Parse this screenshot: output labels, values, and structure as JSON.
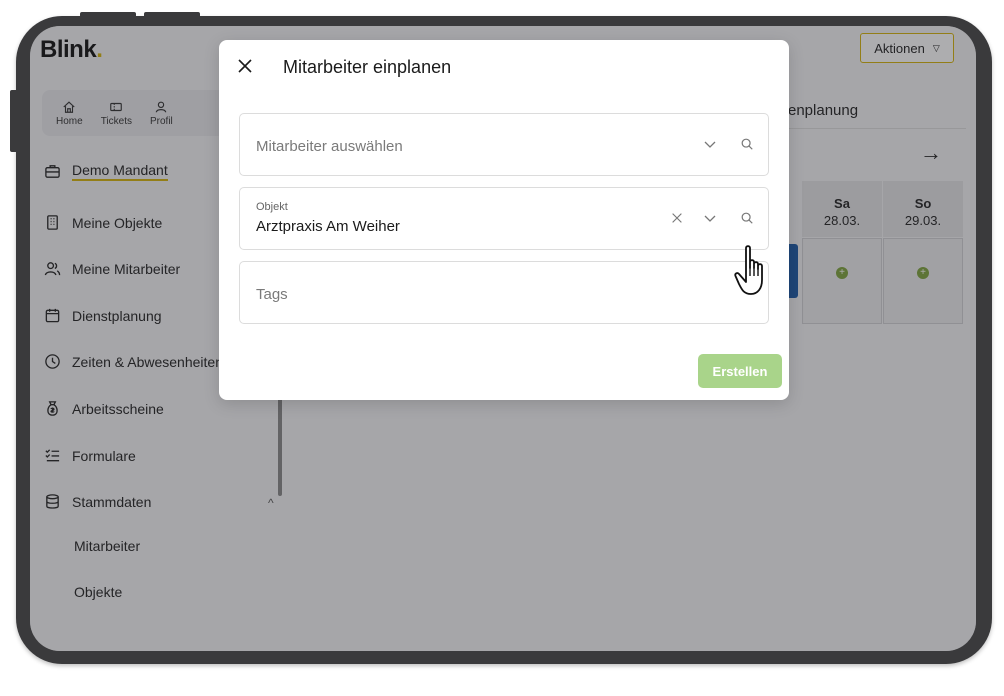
{
  "app": {
    "logo_text": "Blink",
    "logo_dot": ".",
    "actions_label": "Aktionen",
    "brand_color": "#d6b40a"
  },
  "quicknav": [
    {
      "label": "Home",
      "icon": "home-icon"
    },
    {
      "label": "Tickets",
      "icon": "ticket-icon"
    },
    {
      "label": "Profil",
      "icon": "user-icon"
    }
  ],
  "sidebar": {
    "mandant": "Demo Mandant",
    "items": [
      {
        "label": "Meine Objekte",
        "icon": "building-icon"
      },
      {
        "label": "Meine Mitarbeiter",
        "icon": "users-icon"
      },
      {
        "label": "Dienstplanung",
        "icon": "calendar-icon"
      },
      {
        "label": "Zeiten & Abwesenheiten",
        "icon": "clock-icon"
      },
      {
        "label": "Arbeitsscheine",
        "icon": "moneybag-icon"
      },
      {
        "label": "Formulare",
        "icon": "checklist-icon"
      },
      {
        "label": "Stammdaten",
        "icon": "database-icon"
      }
    ],
    "subitems": [
      "Mitarbeiter",
      "Objekte"
    ]
  },
  "planning": {
    "title_partial": "enplanung",
    "days": [
      {
        "name": "Sa",
        "date": "28.03."
      },
      {
        "name": "So",
        "date": "29.03."
      }
    ]
  },
  "modal": {
    "title": "Mitarbeiter einplanen",
    "employee_placeholder": "Mitarbeiter auswählen",
    "object_label": "Objekt",
    "object_value": "Arztpraxis Am Weiher",
    "tags_placeholder": "Tags",
    "create_label": "Erstellen",
    "create_color": "#a9d48a"
  }
}
